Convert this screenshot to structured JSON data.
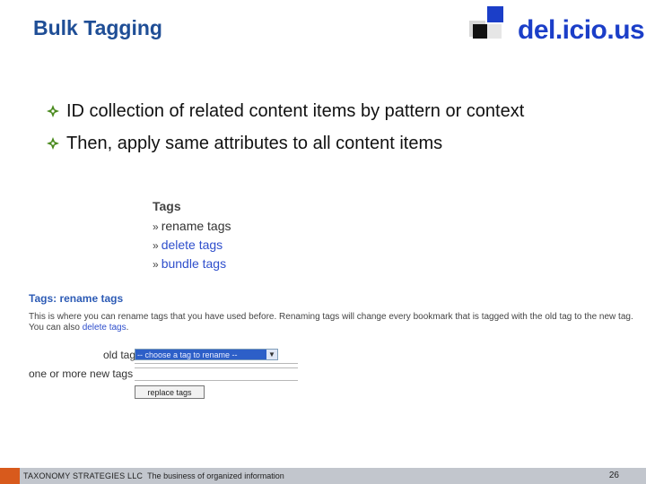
{
  "slide": {
    "title": "Bulk Tagging",
    "logo_text": "del.icio.us",
    "bullets": [
      "ID collection of related content items by pattern or context",
      "Then, apply same attributes to all content items"
    ],
    "colors": {
      "title": "#1f4e96",
      "bullet_mark": "#4a8a1e",
      "logo_blue": "#1b3ec8",
      "footer_bg": "#c2c6cd",
      "footer_corner": "#d85a1c"
    }
  },
  "tags_panel": {
    "title": "Tags",
    "items": [
      {
        "prefix": "»",
        "label": "rename tags"
      },
      {
        "prefix": "»",
        "label": "delete tags"
      },
      {
        "prefix": "»",
        "label": "bundle tags"
      }
    ]
  },
  "rename_panel": {
    "title": "Tags: rename tags",
    "description": "This is where you can rename tags that you have used before. Renaming tags will change every bookmark that is tagged with the old tag to the new tag. You can also",
    "description_link": "delete tags",
    "description_end": ".",
    "old_tag_label": "old tag",
    "old_tag_value": "-- choose a tag to rename --",
    "new_tags_label": "one or more new tags",
    "button_label": "replace tags"
  },
  "footer": {
    "company": "TAXONOMY STRATEGIES LLC",
    "tagline": "The business of organized information",
    "page_number": "26"
  }
}
